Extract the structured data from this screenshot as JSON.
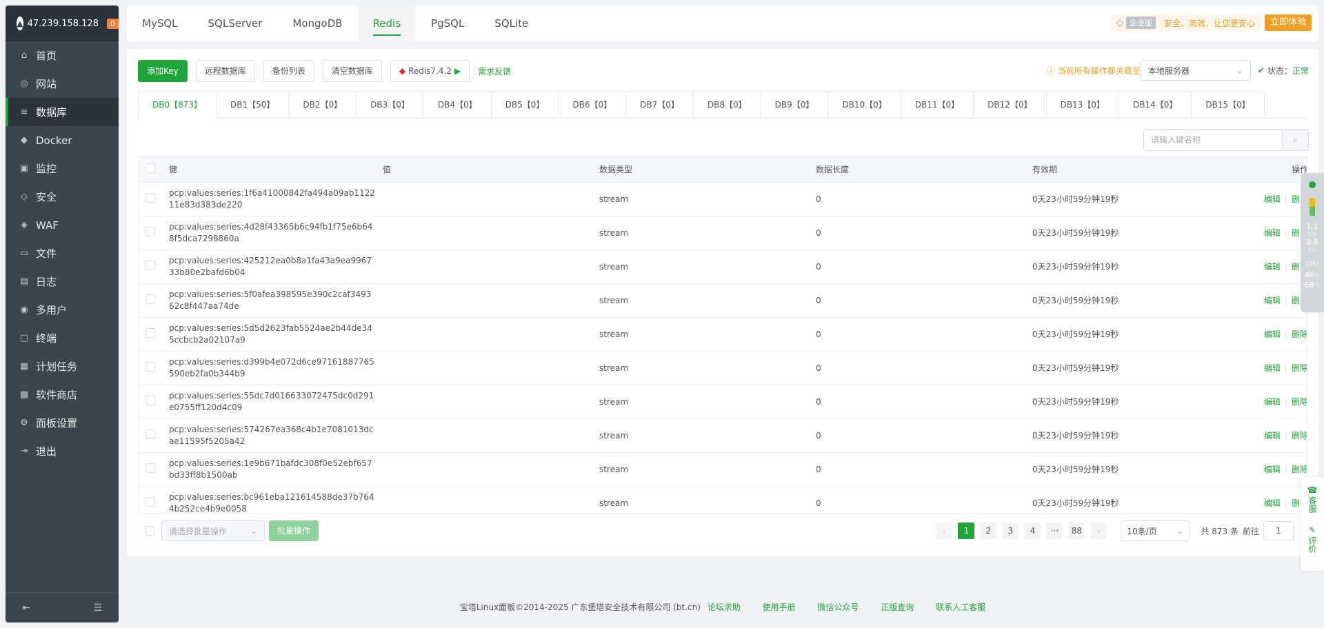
{
  "sidebar": {
    "ip": "47.239.158.128",
    "badge": "0",
    "items": [
      {
        "label": "首页",
        "icon": "home-icon",
        "glyph": "⌂"
      },
      {
        "label": "网站",
        "icon": "globe-icon",
        "glyph": "◎"
      },
      {
        "label": "数据库",
        "icon": "database-icon",
        "glyph": "≡",
        "active": true
      },
      {
        "label": "Docker",
        "icon": "docker-icon",
        "glyph": "◆"
      },
      {
        "label": "监控",
        "icon": "monitor-icon",
        "glyph": "▣"
      },
      {
        "label": "安全",
        "icon": "shield-icon",
        "glyph": "◇"
      },
      {
        "label": "WAF",
        "icon": "waf-icon",
        "glyph": "◈"
      },
      {
        "label": "文件",
        "icon": "folder-icon",
        "glyph": "▭"
      },
      {
        "label": "日志",
        "icon": "log-icon",
        "glyph": "▤"
      },
      {
        "label": "多用户",
        "icon": "users-icon",
        "glyph": "◉"
      },
      {
        "label": "终端",
        "icon": "terminal-icon",
        "glyph": "▢"
      },
      {
        "label": "计划任务",
        "icon": "calendar-icon",
        "glyph": "▦"
      },
      {
        "label": "软件商店",
        "icon": "apps-icon",
        "glyph": "▩"
      },
      {
        "label": "面板设置",
        "icon": "gear-icon",
        "glyph": "⚙"
      },
      {
        "label": "退出",
        "icon": "logout-icon",
        "glyph": "⇥"
      }
    ]
  },
  "topbar": {
    "tabs": [
      "MySQL",
      "SQLServer",
      "MongoDB",
      "Redis",
      "PgSQL",
      "SQLite"
    ],
    "active_tab": "Redis",
    "enterprise_badge": "企业版",
    "slogan": "安全、高效、让您更安心",
    "try_button": "立即体验"
  },
  "toolbar": {
    "add_key": "添加Key",
    "remote_db": "远程数据库",
    "backup_list": "备份列表",
    "clear_db": "清空数据库",
    "redis_version": "Redis7.4.2",
    "feedback": "需求反馈",
    "warning": "当前所有操作都关联至",
    "server_select": "本地服务器",
    "status_label": "状态：",
    "status_value": "正常"
  },
  "db_tabs": [
    "DB0【873】",
    "DB1【50】",
    "DB2【0】",
    "DB3【0】",
    "DB4【0】",
    "DB5【0】",
    "DB6【0】",
    "DB7【0】",
    "DB8【0】",
    "DB9【0】",
    "DB10【0】",
    "DB11【0】",
    "DB12【0】",
    "DB13【0】",
    "DB14【0】",
    "DB15【0】"
  ],
  "search": {
    "placeholder": "请输入键名称"
  },
  "table": {
    "headers": {
      "key": "键",
      "value": "值",
      "type": "数据类型",
      "length": "数据长度",
      "ttl": "有效期",
      "ops": "操作"
    },
    "edit_label": "编辑",
    "delete_label": "删除",
    "rows": [
      {
        "key": "pcp:values:series:1f6a41000842fa494a09ab112211e83d383de220",
        "value": "",
        "type": "stream",
        "length": "0",
        "ttl": "0天23小时59分钟19秒"
      },
      {
        "key": "pcp:values:series:4d28f43365b6c94fb1f75e6b648f5dca7298860a",
        "value": "",
        "type": "stream",
        "length": "0",
        "ttl": "0天23小时59分钟19秒"
      },
      {
        "key": "pcp:values:series:425212ea0b8a1fa43a9ea996733b80e2bafd6b04",
        "value": "",
        "type": "stream",
        "length": "0",
        "ttl": "0天23小时59分钟19秒"
      },
      {
        "key": "pcp:values:series:5f0afea398595e390c2caf349362c8f447aa74de",
        "value": "",
        "type": "stream",
        "length": "0",
        "ttl": "0天23小时59分钟19秒"
      },
      {
        "key": "pcp:values:series:5d5d2623fab5524ae2b44de345ccbcb2a02107a9",
        "value": "",
        "type": "stream",
        "length": "0",
        "ttl": "0天23小时59分钟19秒"
      },
      {
        "key": "pcp:values:series:d399b4e072d6ce97161887765590eb2fa0b344b9",
        "value": "",
        "type": "stream",
        "length": "0",
        "ttl": "0天23小时59分钟19秒"
      },
      {
        "key": "pcp:values:series:55dc7d016633072475dc0d291e0755ff120d4c09",
        "value": "",
        "type": "stream",
        "length": "0",
        "ttl": "0天23小时59分钟19秒"
      },
      {
        "key": "pcp:values:series:574267ea368c4b1e7081013dcae11595f5205a42",
        "value": "",
        "type": "stream",
        "length": "0",
        "ttl": "0天23小时59分钟19秒"
      },
      {
        "key": "pcp:values:series:1e9b671bafdc308f0e52ebf657bd33ff8b1500ab",
        "value": "",
        "type": "stream",
        "length": "0",
        "ttl": "0天23小时59分钟19秒"
      },
      {
        "key": "pcp:values:series:bc961eba121614588de37b7644b252ce4b9e0058",
        "value": "",
        "type": "stream",
        "length": "0",
        "ttl": "0天23小时59分钟19秒"
      }
    ]
  },
  "bottom": {
    "batch_placeholder": "请选择批量操作",
    "batch_button": "批量操作",
    "pages": [
      "1",
      "2",
      "3",
      "4",
      "···",
      "88"
    ],
    "current_page": "1",
    "page_size": "10条/页",
    "total": "共 873 条",
    "goto_label": "前往",
    "goto_value": "1"
  },
  "footer": {
    "copyright": "宝塔Linux面板©2014-2025 广东堡塔安全技术有限公司 (bt.cn)",
    "links": [
      "论坛求助",
      "使用手册",
      "微信公众号",
      "正版查询",
      "联系人工客服"
    ]
  },
  "monitor": {
    "up": "1.1",
    "up_unit": "K/s",
    "down": "0.8",
    "down_unit": "K/s",
    "cpu_label": "CPU",
    "cpu": "46",
    "cpu_unit": "%",
    "temp": "68",
    "temp_unit": "°C"
  },
  "widgets": {
    "service": "客服",
    "review": "评价"
  },
  "colors": {
    "accent": "#20a53a",
    "sidebar_bg": "#3c444d",
    "warning": "#f0a020"
  }
}
